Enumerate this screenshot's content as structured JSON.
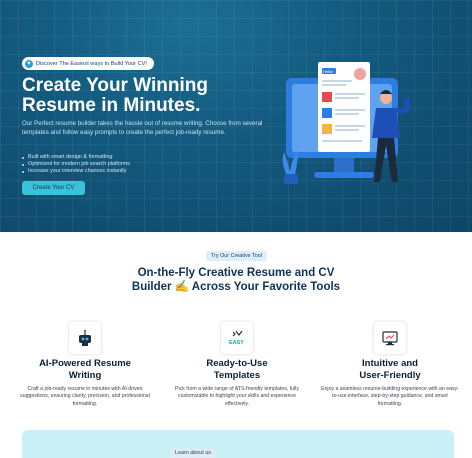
{
  "hero": {
    "pill_text": "Discover The Easiest ways to Build Your CV!",
    "title_line1": "Create Your Winning",
    "title_line2": "Resume in Minutes.",
    "description": "Our Perfect resume builder takes the hassle out of resume writing. Choose from several templates and follow easy prompts to create the perfect job-ready resume.",
    "features": [
      "Built with smart design & formatting",
      "Optimized for modern job search platforms",
      "Increase your interview chances instantly"
    ],
    "cta_label": "Create Your CV",
    "illustration_text": "Hello!"
  },
  "tools": {
    "tag": "Try Our Creative Tool",
    "title_line1": "On-the-Fly Creative Resume and CV",
    "title_line2": "Builder ✍️ Across Your Favorite Tools",
    "cards": [
      {
        "icon": "robot-icon",
        "title_line1": "AI-Powered Resume",
        "title_line2": "Writing",
        "description": "Craft a job-ready resume in minutes with AI-driven suggestions, ensuring clarity, precision, and professional formatting."
      },
      {
        "icon": "easy-icon",
        "icon_text": "EASY",
        "title_line1": "Ready-to-Use",
        "title_line2": "Templates",
        "description": "Pick from a wide range of ATS-friendly templates, fully customizable to highlight your skills and experience effectively."
      },
      {
        "icon": "monitor-icon",
        "title_line1": "Intuitive and",
        "title_line2": "User-Friendly",
        "description": "Enjoy a seamless resume-building experience with an easy-to-use interface, step-by-step guidance, and smart formatting."
      }
    ]
  },
  "about": {
    "tag": "Learn about us"
  },
  "colors": {
    "hero_bg": "#135a7f",
    "accent": "#39c2d8",
    "heading": "#0d3358",
    "about_bg": "#c9f1f5"
  }
}
